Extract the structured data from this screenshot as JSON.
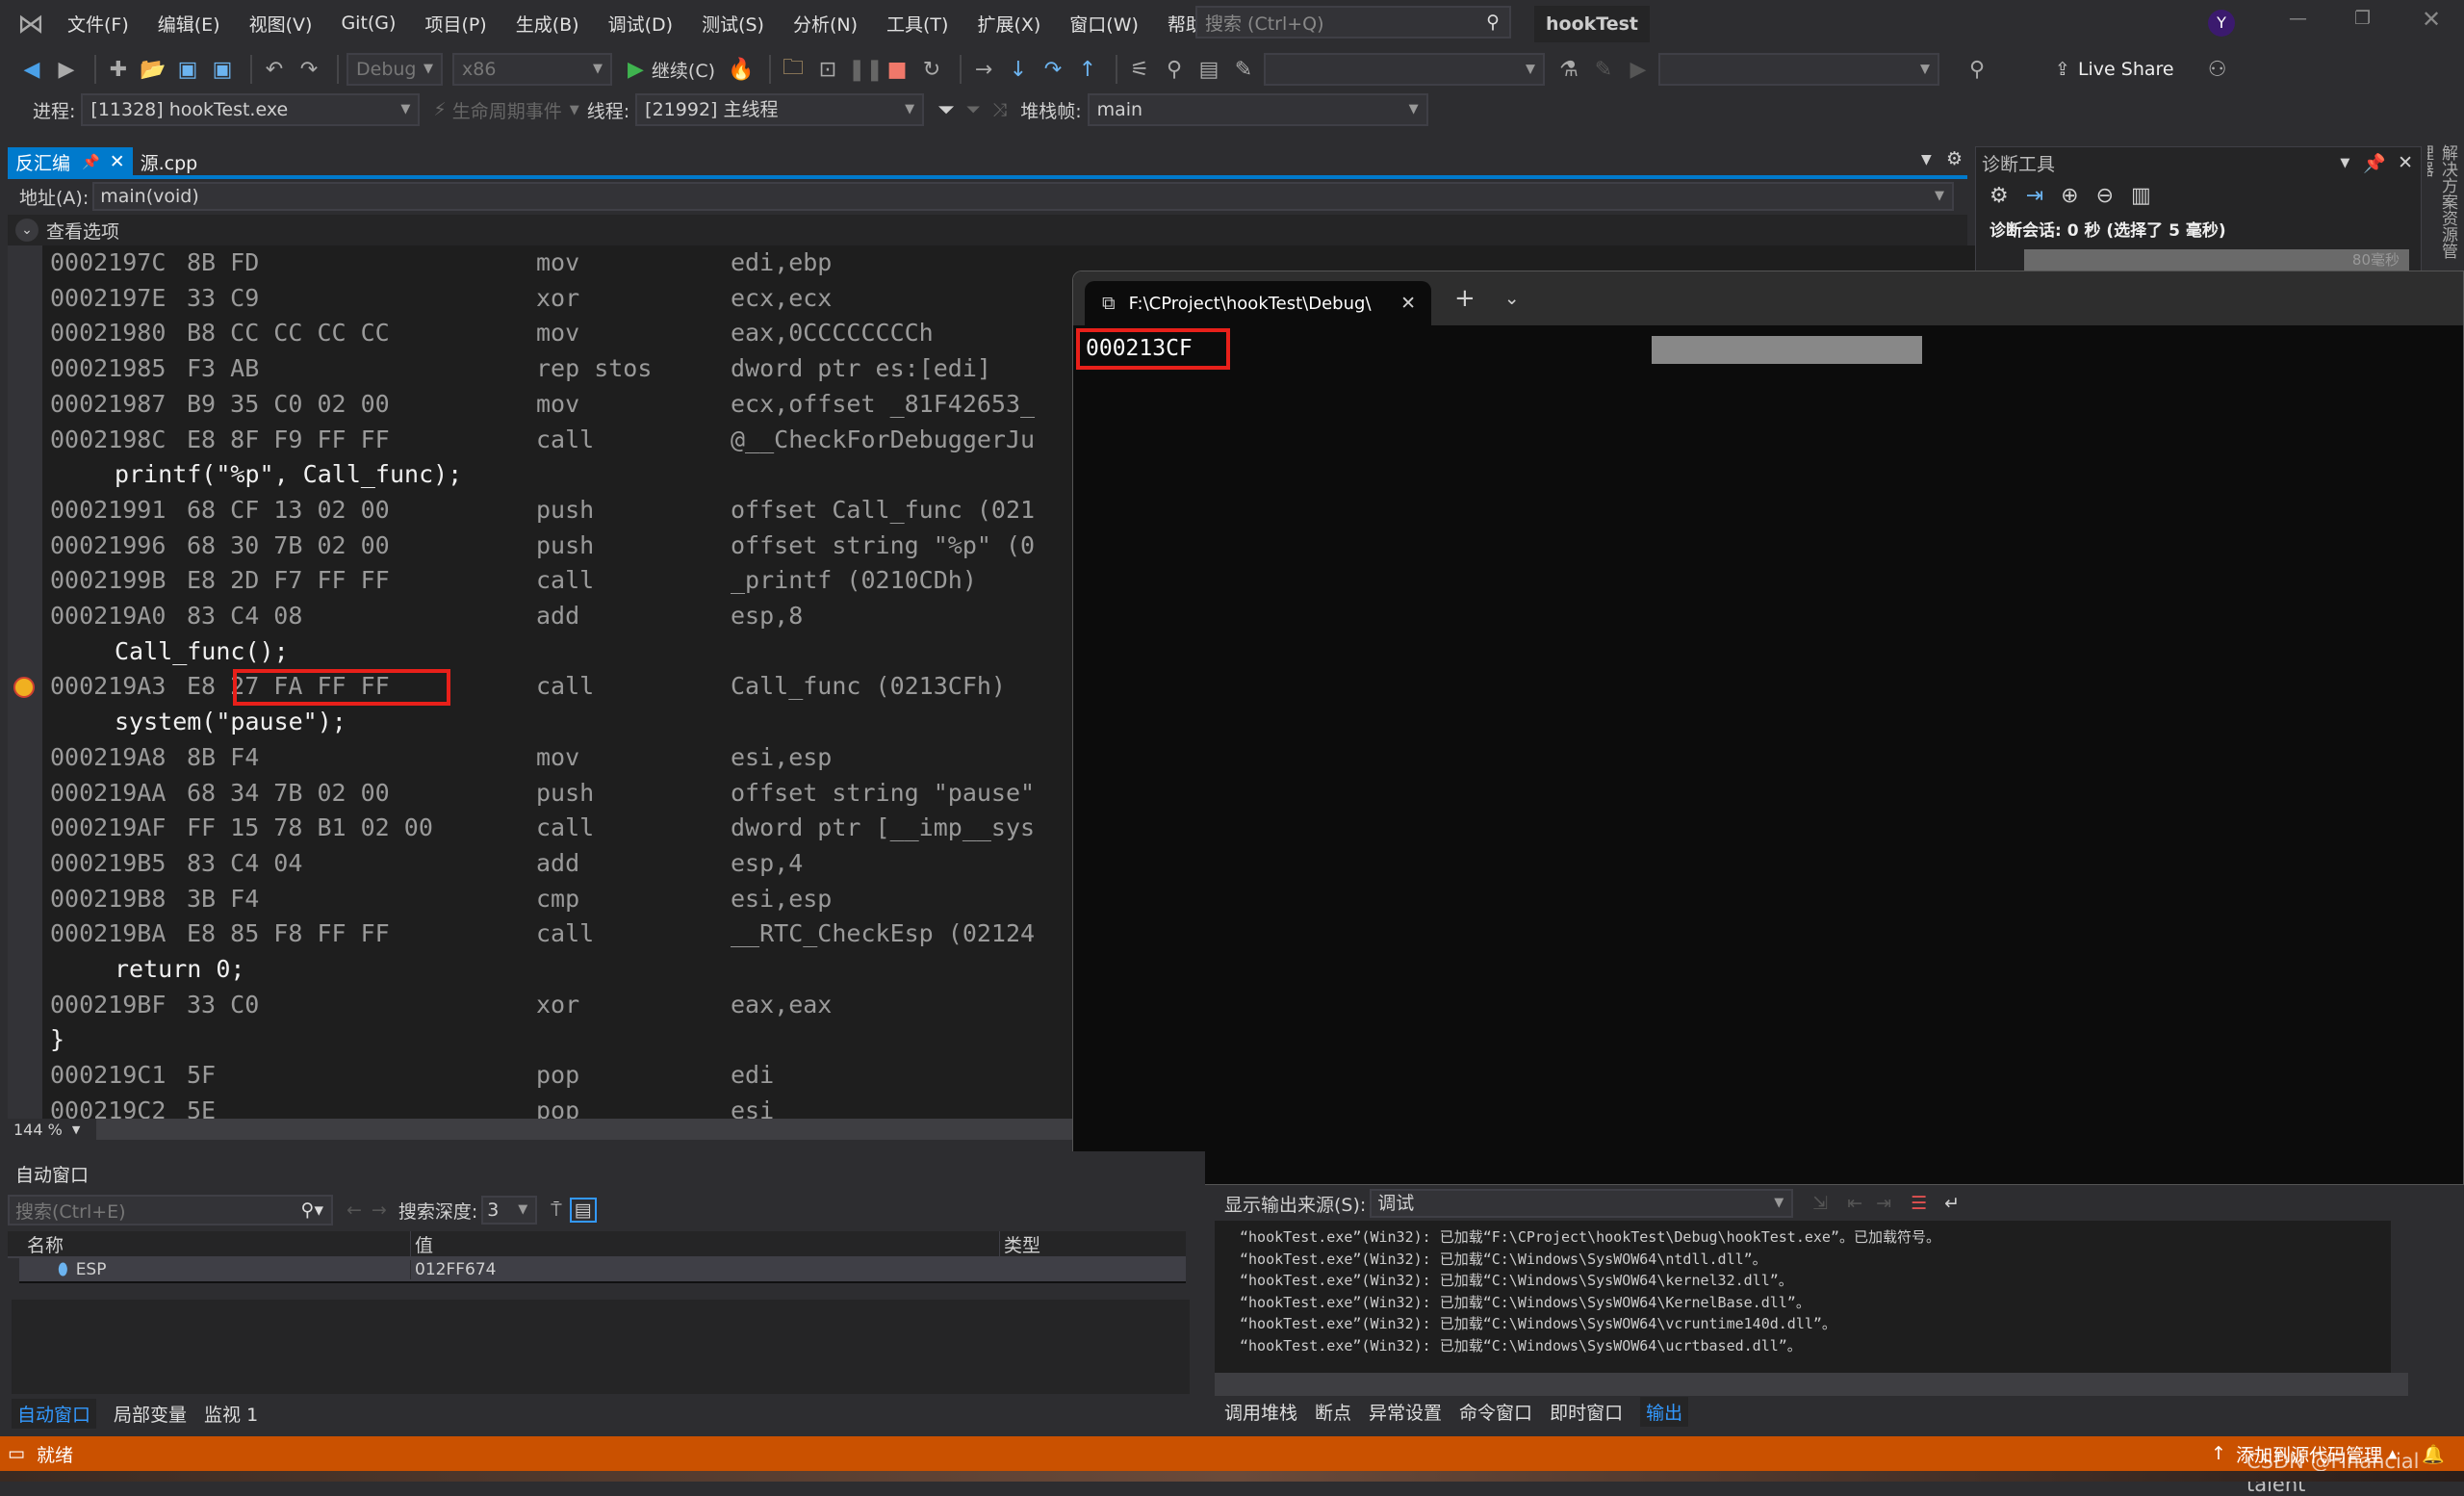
{
  "menubar": {
    "items": [
      "文件(F)",
      "编辑(E)",
      "视图(V)",
      "Git(G)",
      "项目(P)",
      "生成(B)",
      "调试(D)",
      "测试(S)",
      "分析(N)",
      "工具(T)",
      "扩展(X)",
      "窗口(W)",
      "帮助(H)"
    ],
    "search_placeholder": "搜索 (Ctrl+Q)",
    "solution_name": "hookTest",
    "avatar": "Y"
  },
  "toolbar": {
    "config": "Debug",
    "platform": "x86",
    "continue_label": "继续(C)",
    "live_share": "Live Share"
  },
  "debug_location": {
    "process_label": "进程:",
    "process": "[11328] hookTest.exe",
    "lifecycle": "生命周期事件",
    "thread_label": "线程:",
    "thread": "[21992] 主线程",
    "stack_label": "堆栈帧:",
    "stack": "main"
  },
  "doc_tabs": [
    {
      "label": "反汇编",
      "active": true
    },
    {
      "label": "源.cpp",
      "active": false
    }
  ],
  "address": {
    "label": "地址(A):",
    "value": "main(void)"
  },
  "view_options": "查看选项",
  "disassembly": [
    {
      "addr": "0002197C",
      "bytes": "8B FD",
      "op": "mov",
      "args": "edi,ebp"
    },
    {
      "addr": "0002197E",
      "bytes": "33 C9",
      "op": "xor",
      "args": "ecx,ecx"
    },
    {
      "addr": "00021980",
      "bytes": "B8 CC CC CC CC",
      "op": "mov",
      "args": "eax,0CCCCCCCCh"
    },
    {
      "addr": "00021985",
      "bytes": "F3 AB",
      "op": "rep stos",
      "args": "dword ptr es:[edi]"
    },
    {
      "addr": "00021987",
      "bytes": "B9 35 C0 02 00",
      "op": "mov",
      "args": "ecx,offset _81F42653_"
    },
    {
      "addr": "0002198C",
      "bytes": "E8 8F F9 FF FF",
      "op": "call",
      "args": "@__CheckForDebuggerJu"
    },
    {
      "src": "printf(\"%p\", Call_func);"
    },
    {
      "addr": "00021991",
      "bytes": "68 CF 13 02 00",
      "op": "push",
      "args": "offset Call_func (021"
    },
    {
      "addr": "00021996",
      "bytes": "68 30 7B 02 00",
      "op": "push",
      "args": "offset string \"%p\" (0"
    },
    {
      "addr": "0002199B",
      "bytes": "E8 2D F7 FF FF",
      "op": "call",
      "args": "_printf (0210CDh)"
    },
    {
      "addr": "000219A0",
      "bytes": "83 C4 08",
      "op": "add",
      "args": "esp,8"
    },
    {
      "src": "Call_func();"
    },
    {
      "addr": "000219A3",
      "bytes": "E8 27 FA FF FF",
      "op": "call",
      "args": "Call_func (0213CFh)",
      "current": true
    },
    {
      "src": "system(\"pause\");"
    },
    {
      "addr": "000219A8",
      "bytes": "8B F4",
      "op": "mov",
      "args": "esi,esp"
    },
    {
      "addr": "000219AA",
      "bytes": "68 34 7B 02 00",
      "op": "push",
      "args": "offset string \"pause\""
    },
    {
      "addr": "000219AF",
      "bytes": "FF 15 78 B1 02 00",
      "op": "call",
      "args": "dword ptr [__imp__sys"
    },
    {
      "addr": "000219B5",
      "bytes": "83 C4 04",
      "op": "add",
      "args": "esp,4"
    },
    {
      "addr": "000219B8",
      "bytes": "3B F4",
      "op": "cmp",
      "args": "esi,esp"
    },
    {
      "addr": "000219BA",
      "bytes": "E8 85 F8 FF FF",
      "op": "call",
      "args": "__RTC_CheckEsp (02124"
    },
    {
      "src": "return 0;"
    },
    {
      "addr": "000219BF",
      "bytes": "33 C0",
      "op": "xor",
      "args": "eax,eax"
    },
    {
      "src": "}",
      "brace": true
    },
    {
      "addr": "000219C1",
      "bytes": "5F",
      "op": "pop",
      "args": "edi"
    },
    {
      "addr": "000219C2",
      "bytes": "5E",
      "op": "pop",
      "args": "esi"
    }
  ],
  "zoom": "144 %",
  "console": {
    "tab_title": "F:\\CProject\\hookTest\\Debug\\",
    "output": "000213CF"
  },
  "diagnostics": {
    "title": "诊断工具",
    "session": "诊断会话: 0 秒 (选择了 5 毫秒)",
    "timeline_label": "80毫秒"
  },
  "side_strip": "解决方案资源管理器",
  "autos": {
    "title": "自动窗口",
    "search_placeholder": "搜索(Ctrl+E)",
    "depth_label": "搜索深度:",
    "depth": "3",
    "columns": [
      "名称",
      "值",
      "类型"
    ],
    "rows": [
      {
        "name": "ESP",
        "value": "012FF674",
        "type": ""
      }
    ],
    "tabs": [
      "自动窗口",
      "局部变量",
      "监视 1"
    ]
  },
  "output": {
    "source_label": "显示输出来源(S):",
    "source": "调试",
    "lines": [
      "“hookTest.exe”(Win32): 已加载“F:\\CProject\\hookTest\\Debug\\hookTest.exe”。已加载符号。",
      "“hookTest.exe”(Win32): 已加载“C:\\Windows\\SysWOW64\\ntdll.dll”。",
      "“hookTest.exe”(Win32): 已加载“C:\\Windows\\SysWOW64\\kernel32.dll”。",
      "“hookTest.exe”(Win32): 已加载“C:\\Windows\\SysWOW64\\KernelBase.dll”。",
      "“hookTest.exe”(Win32): 已加载“C:\\Windows\\SysWOW64\\vcruntime140d.dll”。",
      "“hookTest.exe”(Win32): 已加载“C:\\Windows\\SysWOW64\\ucrtbased.dll”。"
    ],
    "tabs": [
      "调用堆栈",
      "断点",
      "异常设置",
      "命令窗口",
      "即时窗口",
      "输出"
    ]
  },
  "statusbar": {
    "status": "就绪",
    "source_control": "添加到源代码管理",
    "watermark": "CSDN @Financial talent"
  },
  "colors": {
    "accent": "#007acc",
    "status_bar": "#ca5100",
    "highlight_box": "#e8201a"
  }
}
